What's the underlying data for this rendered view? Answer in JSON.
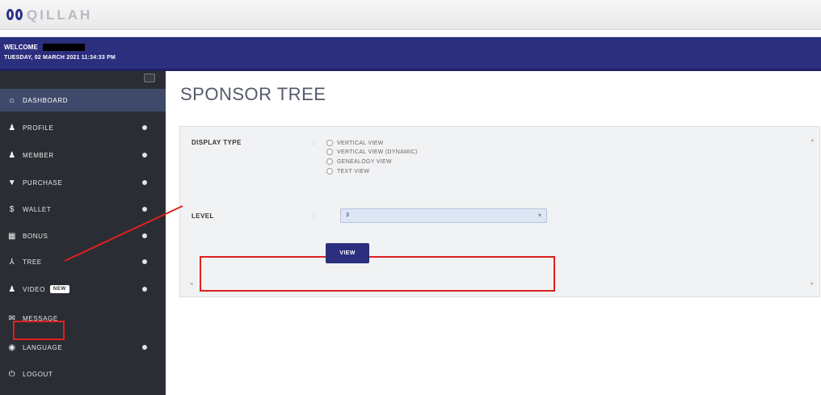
{
  "brand": {
    "name": "QILLAH"
  },
  "header": {
    "welcome": "WELCOME",
    "datetime": "TUESDAY, 02 MARCH 2021 11:34:33 PM"
  },
  "sidebar": {
    "items": [
      {
        "label": "DASHBOARD",
        "icon": "home-icon"
      },
      {
        "label": "PROFILE",
        "icon": "user-icon"
      },
      {
        "label": "MEMBER",
        "icon": "users-icon"
      },
      {
        "label": "PURCHASE",
        "icon": "cart-icon"
      },
      {
        "label": "WALLET",
        "icon": "dollar-icon"
      },
      {
        "label": "BONUS",
        "icon": "grid-icon"
      },
      {
        "label": "TREE",
        "icon": "tree-icon"
      },
      {
        "label": "VIDEO",
        "icon": "user-icon",
        "badge": "NEW"
      },
      {
        "label": "MESSAGE",
        "icon": "envelope-icon"
      },
      {
        "label": "LANGUAGE",
        "icon": "globe-icon"
      },
      {
        "label": "LOGOUT",
        "icon": "power-icon"
      }
    ]
  },
  "main": {
    "title": "SPONSOR TREE",
    "display_type_label": "DISPLAY TYPE",
    "separator": ":",
    "options": [
      "VERTICAL VIEW",
      "VERTICAL VIEW (DYNAMIC)",
      "GENEALOGY VIEW",
      "TEXT VIEW"
    ],
    "level_label": "LEVEL",
    "level_value": "3",
    "view_button": "VIEW"
  },
  "colors": {
    "header": "#2b2f7e",
    "sidebar": "#2a2d33",
    "active": "#3f4a6b",
    "highlight": "#e02020"
  }
}
